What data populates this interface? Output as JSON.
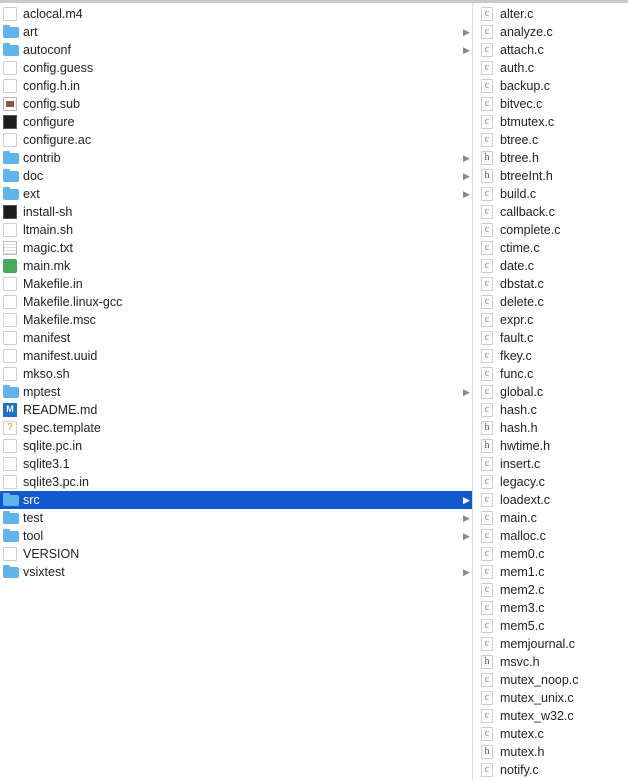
{
  "left_column": {
    "items": [
      {
        "name": "aclocal.m4",
        "icon": "doc"
      },
      {
        "name": "art",
        "icon": "folder",
        "has_children": true
      },
      {
        "name": "autoconf",
        "icon": "folder",
        "has_children": true
      },
      {
        "name": "config.guess",
        "icon": "doc"
      },
      {
        "name": "config.h.in",
        "icon": "doc"
      },
      {
        "name": "config.sub",
        "icon": "script"
      },
      {
        "name": "configure",
        "icon": "exec"
      },
      {
        "name": "configure.ac",
        "icon": "doc"
      },
      {
        "name": "contrib",
        "icon": "folder",
        "has_children": true
      },
      {
        "name": "doc",
        "icon": "folder",
        "has_children": true
      },
      {
        "name": "ext",
        "icon": "folder",
        "has_children": true
      },
      {
        "name": "install-sh",
        "icon": "exec"
      },
      {
        "name": "ltmain.sh",
        "icon": "doc"
      },
      {
        "name": "magic.txt",
        "icon": "text"
      },
      {
        "name": "main.mk",
        "icon": "green"
      },
      {
        "name": "Makefile.in",
        "icon": "doc"
      },
      {
        "name": "Makefile.linux-gcc",
        "icon": "doc"
      },
      {
        "name": "Makefile.msc",
        "icon": "doc"
      },
      {
        "name": "manifest",
        "icon": "doc"
      },
      {
        "name": "manifest.uuid",
        "icon": "doc"
      },
      {
        "name": "mkso.sh",
        "icon": "doc"
      },
      {
        "name": "mptest",
        "icon": "folder",
        "has_children": true
      },
      {
        "name": "README.md",
        "icon": "md"
      },
      {
        "name": "spec.template",
        "icon": "tmpl"
      },
      {
        "name": "sqlite.pc.in",
        "icon": "doc"
      },
      {
        "name": "sqlite3.1",
        "icon": "doc"
      },
      {
        "name": "sqlite3.pc.in",
        "icon": "doc"
      },
      {
        "name": "src",
        "icon": "folder",
        "has_children": true,
        "selected": true
      },
      {
        "name": "test",
        "icon": "folder",
        "has_children": true
      },
      {
        "name": "tool",
        "icon": "folder",
        "has_children": true
      },
      {
        "name": "VERSION",
        "icon": "doc"
      },
      {
        "name": "vsixtest",
        "icon": "folder",
        "has_children": true
      }
    ]
  },
  "right_column": {
    "items": [
      {
        "name": "alter.c",
        "icon": "c"
      },
      {
        "name": "analyze.c",
        "icon": "c"
      },
      {
        "name": "attach.c",
        "icon": "c"
      },
      {
        "name": "auth.c",
        "icon": "c"
      },
      {
        "name": "backup.c",
        "icon": "c"
      },
      {
        "name": "bitvec.c",
        "icon": "c"
      },
      {
        "name": "btmutex.c",
        "icon": "c"
      },
      {
        "name": "btree.c",
        "icon": "c"
      },
      {
        "name": "btree.h",
        "icon": "h"
      },
      {
        "name": "btreeInt.h",
        "icon": "h"
      },
      {
        "name": "build.c",
        "icon": "c"
      },
      {
        "name": "callback.c",
        "icon": "c"
      },
      {
        "name": "complete.c",
        "icon": "c"
      },
      {
        "name": "ctime.c",
        "icon": "c"
      },
      {
        "name": "date.c",
        "icon": "c"
      },
      {
        "name": "dbstat.c",
        "icon": "c"
      },
      {
        "name": "delete.c",
        "icon": "c"
      },
      {
        "name": "expr.c",
        "icon": "c"
      },
      {
        "name": "fault.c",
        "icon": "c"
      },
      {
        "name": "fkey.c",
        "icon": "c"
      },
      {
        "name": "func.c",
        "icon": "c"
      },
      {
        "name": "global.c",
        "icon": "c"
      },
      {
        "name": "hash.c",
        "icon": "c"
      },
      {
        "name": "hash.h",
        "icon": "h"
      },
      {
        "name": "hwtime.h",
        "icon": "h"
      },
      {
        "name": "insert.c",
        "icon": "c"
      },
      {
        "name": "legacy.c",
        "icon": "c"
      },
      {
        "name": "loadext.c",
        "icon": "c"
      },
      {
        "name": "main.c",
        "icon": "c"
      },
      {
        "name": "malloc.c",
        "icon": "c"
      },
      {
        "name": "mem0.c",
        "icon": "c"
      },
      {
        "name": "mem1.c",
        "icon": "c"
      },
      {
        "name": "mem2.c",
        "icon": "c"
      },
      {
        "name": "mem3.c",
        "icon": "c"
      },
      {
        "name": "mem5.c",
        "icon": "c"
      },
      {
        "name": "memjournal.c",
        "icon": "c"
      },
      {
        "name": "msvc.h",
        "icon": "h"
      },
      {
        "name": "mutex_noop.c",
        "icon": "c"
      },
      {
        "name": "mutex_unix.c",
        "icon": "c"
      },
      {
        "name": "mutex_w32.c",
        "icon": "c"
      },
      {
        "name": "mutex.c",
        "icon": "c"
      },
      {
        "name": "mutex.h",
        "icon": "h"
      },
      {
        "name": "notify.c",
        "icon": "c"
      }
    ]
  },
  "colors": {
    "selection": "#1259cf",
    "folder": "#5fb4ec"
  }
}
